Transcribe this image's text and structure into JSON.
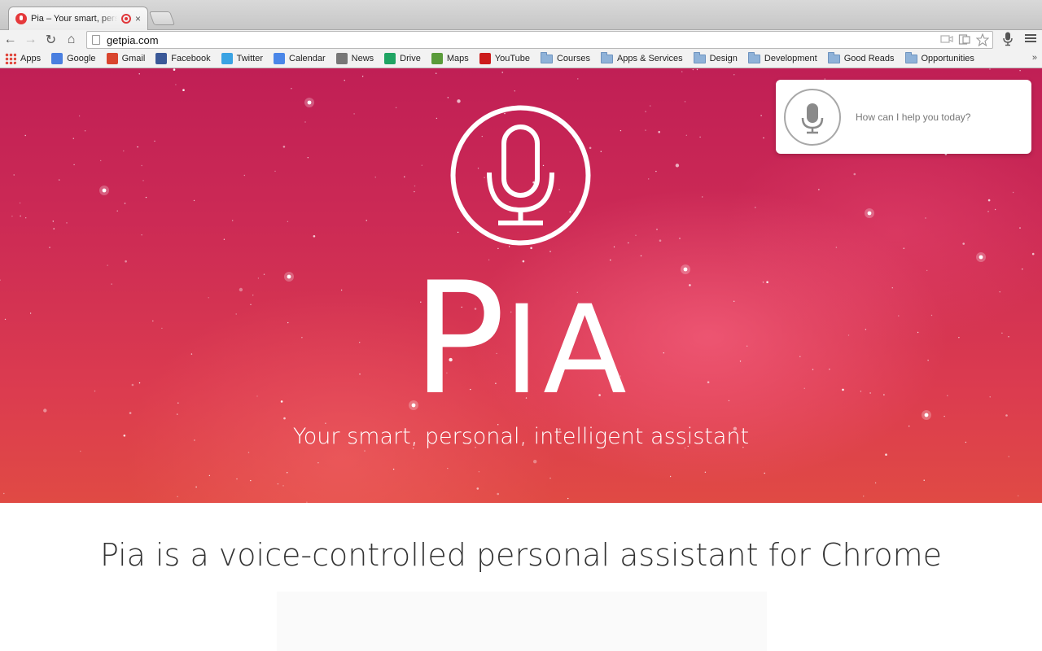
{
  "browser": {
    "tab_title": "Pia – Your smart, personal, intelligent assistant",
    "tab_close": "×",
    "url": "getpia.com",
    "nav": {
      "back": "←",
      "forward": "→",
      "reload": "↻",
      "home": "⌂"
    },
    "omnibox_icons": [
      "camera-icon",
      "page-action-icon",
      "star-icon"
    ],
    "toolbar_icons": [
      "mic-extension-icon",
      "menu-icon"
    ]
  },
  "bookmarks": [
    {
      "label": "Apps",
      "icon": "apps-grid-icon",
      "color": "#e0463c"
    },
    {
      "label": "Google",
      "icon": "google-icon",
      "color": "#4a7fe0"
    },
    {
      "label": "Gmail",
      "icon": "gmail-icon",
      "color": "#d9452e"
    },
    {
      "label": "Facebook",
      "icon": "facebook-icon",
      "color": "#3b5998"
    },
    {
      "label": "Twitter",
      "icon": "twitter-icon",
      "color": "#3aa3e3"
    },
    {
      "label": "Calendar",
      "icon": "calendar-icon",
      "color": "#4a86e8"
    },
    {
      "label": "News",
      "icon": "news-icon",
      "color": "#777777"
    },
    {
      "label": "Drive",
      "icon": "drive-icon",
      "color": "#1fa463"
    },
    {
      "label": "Maps",
      "icon": "maps-icon",
      "color": "#5a9b3a"
    },
    {
      "label": "YouTube",
      "icon": "youtube-icon",
      "color": "#cc1c1c"
    },
    {
      "label": "Courses",
      "icon": "folder-icon"
    },
    {
      "label": "Apps & Services",
      "icon": "folder-icon"
    },
    {
      "label": "Design",
      "icon": "folder-icon"
    },
    {
      "label": "Development",
      "icon": "folder-icon"
    },
    {
      "label": "Good Reads",
      "icon": "folder-icon"
    },
    {
      "label": "Opportunities",
      "icon": "folder-icon"
    }
  ],
  "bookmarks_overflow": "»",
  "hero": {
    "brand_P": "P",
    "brand_rest": "IA",
    "tagline": "Your smart, personal, intelligent assistant",
    "accent": "#c8234f"
  },
  "assistant_widget": {
    "prompt": "How can I help you today?"
  },
  "content": {
    "headline": "Pia is a voice-controlled personal assistant for Chrome"
  }
}
